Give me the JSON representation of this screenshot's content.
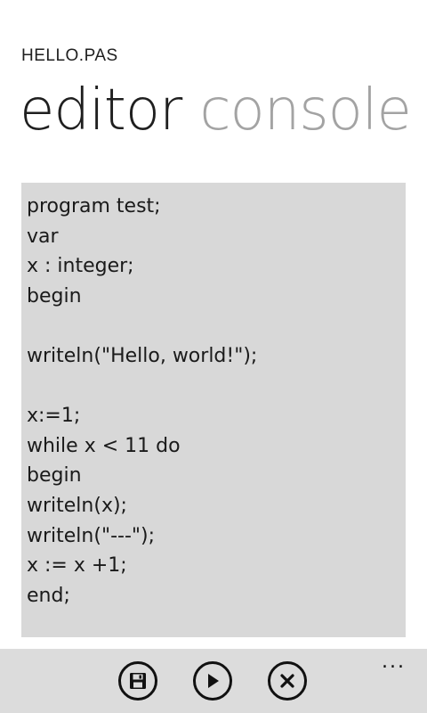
{
  "header": {
    "app_title": "HELLO.PAS"
  },
  "pivot": {
    "tabs": [
      {
        "label": "editor",
        "active": true
      },
      {
        "label": "console",
        "active": false
      }
    ]
  },
  "editor": {
    "lines": [
      "program test;",
      "var",
      "x : integer;",
      "begin",
      "",
      "writeln(\"Hello, world!\");",
      "",
      "x:=1;",
      "while x < 11 do",
      "begin",
      "writeln(x);",
      "writeln(\"---\");",
      "x := x +1;",
      "end;"
    ]
  },
  "app_bar": {
    "buttons": [
      {
        "name": "save",
        "icon": "save-icon"
      },
      {
        "name": "run",
        "icon": "play-icon"
      },
      {
        "name": "close",
        "icon": "close-icon"
      }
    ],
    "more": "..."
  }
}
